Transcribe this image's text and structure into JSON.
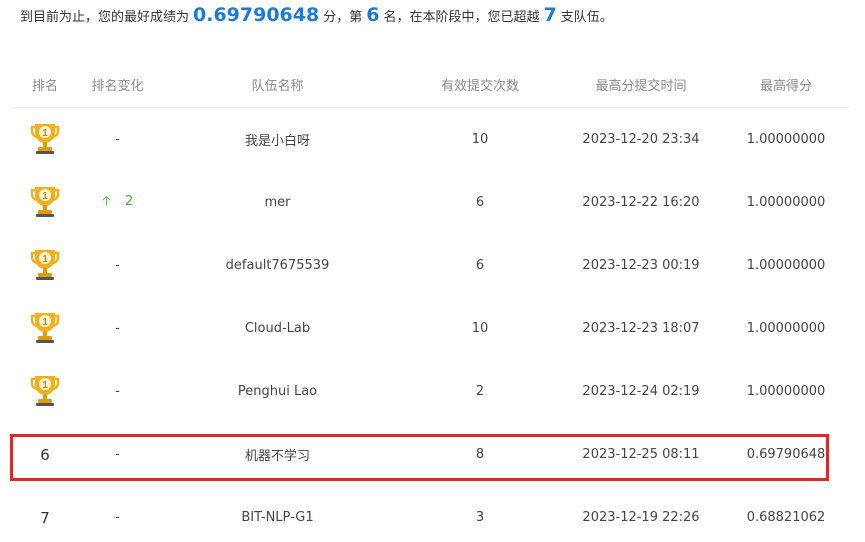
{
  "summary": {
    "prefix": "到目前为止，您的最好成绩为",
    "best_score": "0.69790648",
    "mid1": "分，第",
    "rank": "6",
    "mid2": "名，在本阶段中，您已超越",
    "beaten": "7",
    "suffix": "支队伍。"
  },
  "columns": {
    "rank": "排名",
    "change": "排名变化",
    "team": "队伍名称",
    "submissions": "有效提交次数",
    "time": "最高分提交时间",
    "score": "最高得分"
  },
  "rows": [
    {
      "rank": "1",
      "trophy": true,
      "change": "-",
      "team": "我是小白呀",
      "submissions": "10",
      "time": "2023-12-20 23:34",
      "score": "1.00000000"
    },
    {
      "rank": "1",
      "trophy": true,
      "change_up": "2",
      "team": "mer",
      "submissions": "6",
      "time": "2023-12-22 16:20",
      "score": "1.00000000"
    },
    {
      "rank": "1",
      "trophy": true,
      "change": "-",
      "team": "default7675539",
      "submissions": "6",
      "time": "2023-12-23 00:19",
      "score": "1.00000000"
    },
    {
      "rank": "1",
      "trophy": true,
      "change": "-",
      "team": "Cloud-Lab",
      "submissions": "10",
      "time": "2023-12-23 18:07",
      "score": "1.00000000"
    },
    {
      "rank": "1",
      "trophy": true,
      "change": "-",
      "team": "Penghui Lao",
      "submissions": "2",
      "time": "2023-12-24 02:19",
      "score": "1.00000000"
    },
    {
      "rank": "6",
      "trophy": false,
      "change": "-",
      "team": "机器不学习",
      "submissions": "8",
      "time": "2023-12-25 08:11",
      "score": "0.69790648"
    },
    {
      "rank": "7",
      "trophy": false,
      "change": "-",
      "team": "BIT-NLP-G1",
      "submissions": "3",
      "time": "2023-12-19 22:26",
      "score": "0.68821062"
    }
  ],
  "colors": {
    "accent": "#1e7ad6",
    "highlight": "#d52b2b",
    "up": "#4caa3a",
    "trophy": "#f2b01e"
  },
  "icons": {
    "trophy": "trophy-icon",
    "up": "arrow-up-icon"
  }
}
